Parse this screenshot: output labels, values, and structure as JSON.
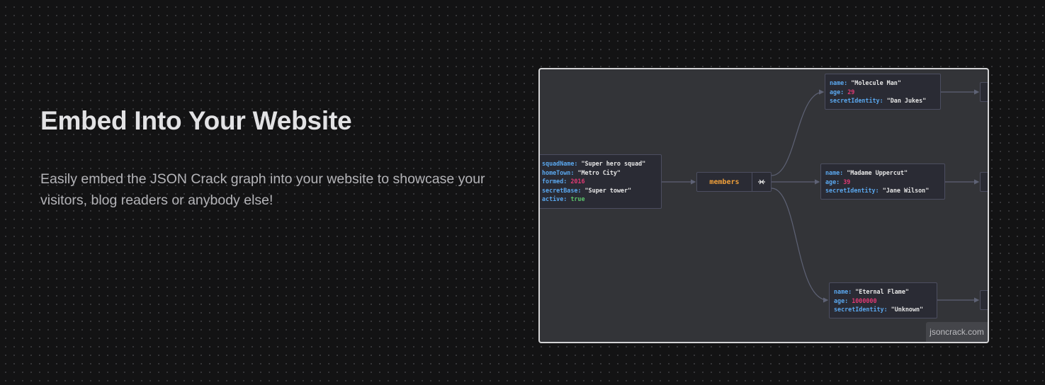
{
  "hero": {
    "title": "Embed Into Your Website",
    "description": "Easily embed the JSON Crack graph into your website to showcase your visitors, blog readers or anybody else!"
  },
  "graph": {
    "root": {
      "squadName_key": "squadName:",
      "squadName": "\"Super hero squad\"",
      "homeTown_key": "homeTown:",
      "homeTown": "\"Metro City\"",
      "formed_key": "formed:",
      "formed": "2016",
      "secretBase_key": "secretBase:",
      "secretBase": "\"Super tower\"",
      "active_key": "active:",
      "active": "true"
    },
    "members_label": "members",
    "collapse_icon": "collapse-icon",
    "members": [
      {
        "name_key": "name:",
        "name": "\"Molecule Man\"",
        "age_key": "age:",
        "age": "29",
        "secret_key": "secretIdentity:",
        "secret": "\"Dan Jukes\""
      },
      {
        "name_key": "name:",
        "name": "\"Madame Uppercut\"",
        "age_key": "age:",
        "age": "39",
        "secret_key": "secretIdentity:",
        "secret": "\"Jane Wilson\""
      },
      {
        "name_key": "name:",
        "name": "\"Eternal Flame\"",
        "age_key": "age:",
        "age": "1000000",
        "secret_key": "secretIdentity:",
        "secret": "\"Unknown\""
      }
    ],
    "watermark": "jsoncrack.com"
  },
  "colors": {
    "background": "#131314",
    "canvas": "#333438",
    "node": "#2a2b34",
    "key": "#5aa7ee",
    "string": "#e6e6e6",
    "number": "#e03a74",
    "boolean": "#5bc26b",
    "members_label": "#f1a03a",
    "edge": "#5e6275"
  }
}
